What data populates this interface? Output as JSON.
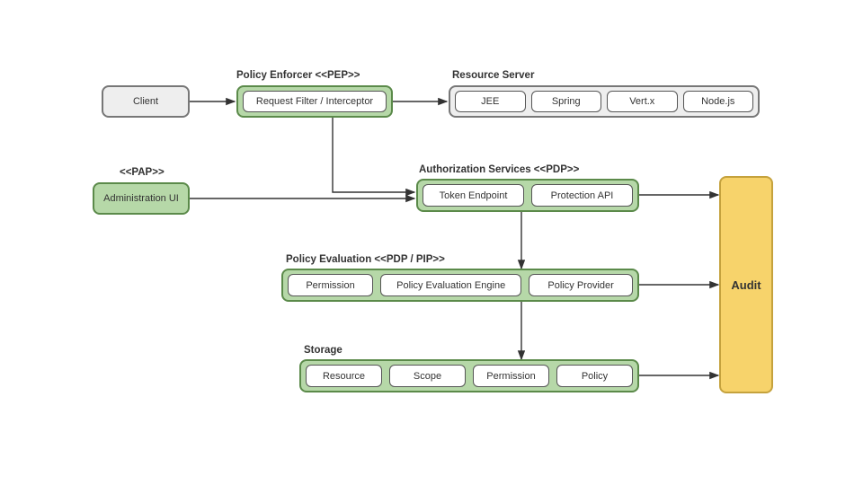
{
  "diagram": {
    "client": "Client",
    "pep_title": "Policy Enforcer <<PEP>>",
    "pep_box": "Request Filter / Interceptor",
    "rs_title": "Resource Server",
    "rs_items": [
      "JEE",
      "Spring",
      "Vert.x",
      "Node.js"
    ],
    "pap_title": "<<PAP>>",
    "pap_box": "Administration UI",
    "pdp_title": "Authorization Services <<PDP>>",
    "pdp_items": [
      "Token Endpoint",
      "Protection API"
    ],
    "peval_title": "Policy Evaluation <<PDP / PIP>>",
    "peval_items": [
      "Permission",
      "Policy Evaluation Engine",
      "Policy Provider"
    ],
    "storage_title": "Storage",
    "storage_items": [
      "Resource",
      "Scope",
      "Permission",
      "Policy"
    ],
    "audit": "Audit"
  }
}
